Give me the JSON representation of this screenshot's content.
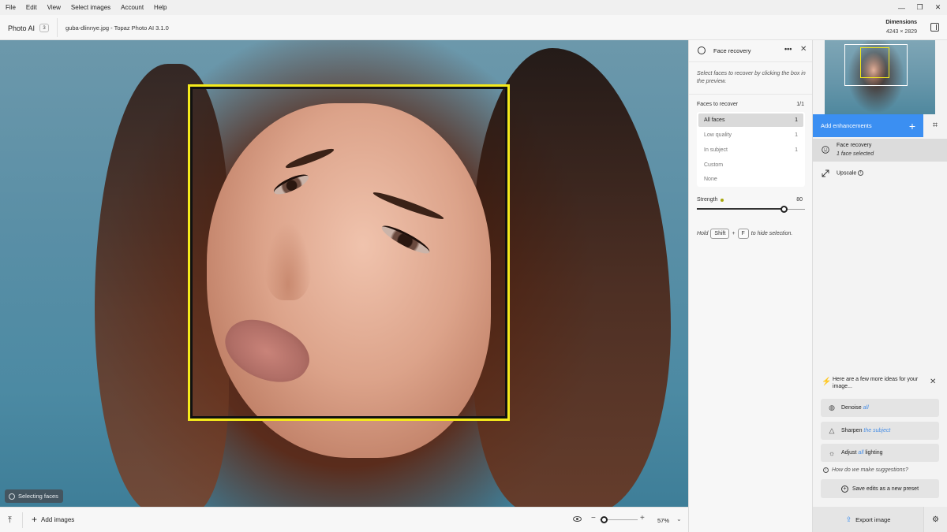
{
  "menu": [
    "File",
    "Edit",
    "View",
    "Select images",
    "Account",
    "Help"
  ],
  "window_controls": {
    "minimize": "—",
    "restore": "❐",
    "close": "✕"
  },
  "header": {
    "app_name": "Photo AI",
    "image_count": "3",
    "filename": "guba-dlinnye.jpg - Topaz Photo AI 3.1.0",
    "dimensions_label": "Dimensions",
    "dimensions_value": "4243 × 2829"
  },
  "canvas": {
    "status_badge": "Selecting faces",
    "accent_face_box": "#f5ea1b"
  },
  "bottom_bar": {
    "add_images": "Add images",
    "zoom": "57%",
    "zoom_level": 0.06
  },
  "face_recovery": {
    "title": "Face recovery",
    "more": "•••",
    "help": "Select faces to recover by clicking the box in the preview.",
    "faces_label": "Faces to recover",
    "faces_count": "1/1",
    "options": [
      {
        "label": "All faces",
        "count": "1",
        "selected": true
      },
      {
        "label": "Low quality",
        "count": "1",
        "selected": false
      },
      {
        "label": "In subject",
        "count": "1",
        "selected": false
      },
      {
        "label": "Custom",
        "count": "",
        "selected": false
      },
      {
        "label": "None",
        "count": "",
        "selected": false
      }
    ],
    "strength_label": "Strength",
    "strength_value": "80",
    "strength": 80,
    "hold_prefix": "Hold",
    "key_shift": "Shift",
    "key_plus": "+",
    "key_f": "F",
    "hold_suffix": "to hide selection."
  },
  "right_panel": {
    "add_enhancements": "Add enhancements",
    "enhancements": [
      {
        "name": "Face recovery",
        "sub": "1 face selected",
        "icon": "smile-icon",
        "active": true
      },
      {
        "name": "Upscale",
        "sub": "",
        "icon": "upscale-arrow-icon",
        "active": false
      }
    ],
    "ideas_title": "Here are a few more ideas for your image...",
    "ideas": [
      {
        "icon": "globe-icon",
        "prefix": "Denoise",
        "highlight": "all",
        "suffix": ""
      },
      {
        "icon": "triangle-icon",
        "prefix": "Sharpen",
        "highlight": "the subject",
        "suffix": ""
      },
      {
        "icon": "sun-icon",
        "prefix": "Adjust",
        "highlight": "all",
        "suffix": "lighting"
      }
    ],
    "how_suggest": "How do we make suggestions?",
    "save_preset": "Save edits as a new preset",
    "export": "Export image",
    "accent": "#3b8ff2"
  }
}
